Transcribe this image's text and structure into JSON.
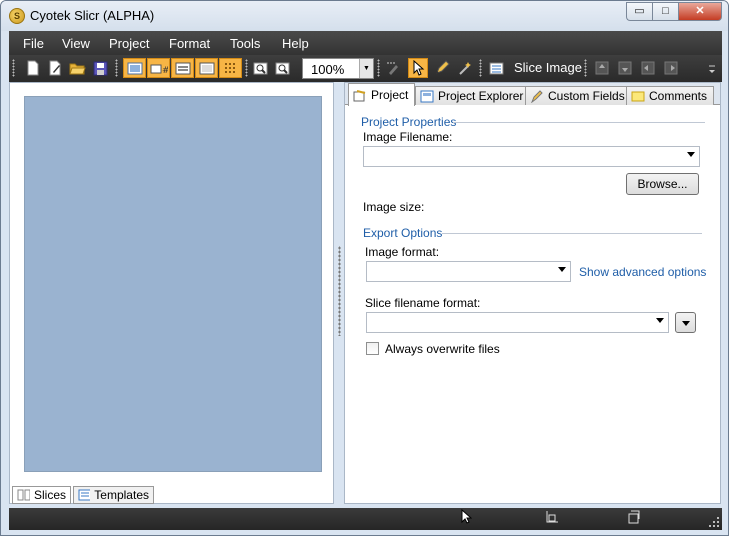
{
  "window": {
    "title": "Cyotek Slicr (ALPHA)",
    "app_icon_glyph": "S",
    "controls": {
      "minimize": "▭",
      "maximize": "□",
      "close": "✕"
    }
  },
  "menu": [
    "File",
    "View",
    "Project",
    "Format",
    "Tools",
    "Help"
  ],
  "toolbar": {
    "zoom_value": "100%",
    "slice_image_label": "Slice Image",
    "icons": [
      "new-file-icon",
      "edit-file-icon",
      "open-folder-icon",
      "save-icon",
      "image-icon",
      "image-slice-icon",
      "panel-icon",
      "panel-alt-icon",
      "grid-icon",
      "zoom-in-icon",
      "zoom-fit-icon",
      "pointer-icon",
      "pencil-icon",
      "wand-icon",
      "move-up-icon",
      "move-down-icon",
      "move-left-icon",
      "move-right-icon"
    ],
    "accent_color": "#f7b545"
  },
  "left_panel": {
    "canvas_color": "#9ab3d0",
    "tabs": [
      "Slices",
      "Templates"
    ],
    "selected_tab": "Slices"
  },
  "right_panel": {
    "tabs": [
      "Project",
      "Project Explorer",
      "Custom Fields",
      "Comments"
    ],
    "selected_tab": "Project",
    "project_properties": {
      "heading": "Project Properties",
      "image_filename_label": "Image Filename:",
      "image_filename_value": "",
      "browse_label": "Browse...",
      "image_size_label": "Image size:",
      "image_size_value": ""
    },
    "export_options": {
      "heading": "Export Options",
      "image_format_label": "Image format:",
      "image_format_value": "",
      "advanced_link": "Show advanced options",
      "slice_filename_label": "Slice filename format:",
      "slice_filename_value": "",
      "overwrite_label": "Always overwrite files",
      "overwrite_checked": false
    }
  },
  "colors": {
    "link": "#1f5ea8",
    "chrome_dark": "#333333",
    "window_frame": "#d9e4f1"
  }
}
